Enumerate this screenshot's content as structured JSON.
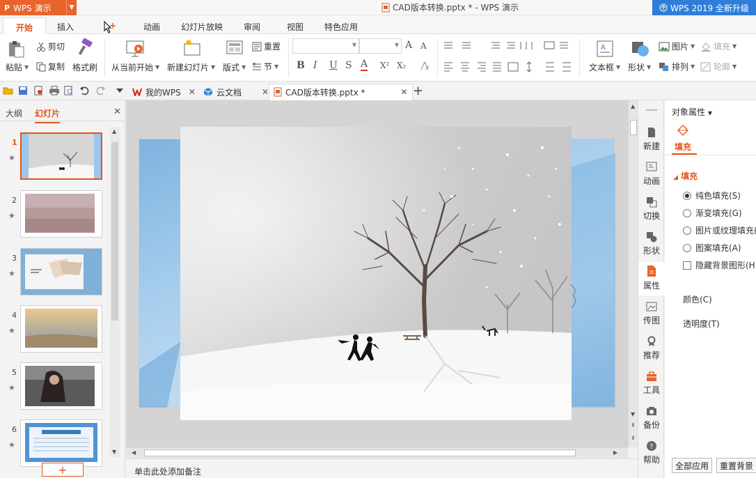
{
  "titlebar": {
    "app_button": "WPS 演示",
    "app_logo": "P",
    "document_title": "CAD版本转换.pptx * - WPS 演示",
    "upgrade": "WPS 2019 全新升级"
  },
  "ribbon_tabs": [
    "开始",
    "插入",
    "设计",
    "动画",
    "幻灯片放映",
    "审阅",
    "视图",
    "特色应用"
  ],
  "ribbon": {
    "paste": "粘贴",
    "cut": "剪切",
    "copy": "复制",
    "format_painter": "格式刷",
    "from_current": "从当前开始",
    "new_slide": "新建幻灯片",
    "layout": "版式",
    "reset": "重置",
    "section": "节",
    "textbox": "文本框",
    "shape": "形状",
    "picture": "图片",
    "fill": "填充",
    "arrange": "排列",
    "outline": "轮廓",
    "font_size_up": "A",
    "font_size_down": "A",
    "bold": "B",
    "italic": "I",
    "underline": "U",
    "strike": "S",
    "font_color": "A",
    "superscript": "X²",
    "subscript": "X₂"
  },
  "quickbar": {
    "tabs": [
      {
        "label": "我的WPS"
      },
      {
        "label": "云文档"
      },
      {
        "label": "CAD版本转换.pptx *"
      }
    ]
  },
  "left_panel": {
    "tab_outline": "大纲",
    "tab_slides": "幻灯片",
    "slides": [
      {
        "num": "1"
      },
      {
        "num": "2"
      },
      {
        "num": "3"
      },
      {
        "num": "4"
      },
      {
        "num": "5"
      },
      {
        "num": "6"
      }
    ],
    "add": "+"
  },
  "notes": {
    "placeholder": "单击此处添加备注"
  },
  "sidebar": [
    "新建",
    "动画",
    "切换",
    "形状",
    "属性",
    "传图",
    "推荐",
    "工具",
    "备份",
    "帮助"
  ],
  "props": {
    "header": "对象属性",
    "tab_fill": "填充",
    "section_fill": "填充",
    "options": [
      {
        "label": "纯色填充(S)",
        "checked": true
      },
      {
        "label": "渐变填充(G)",
        "checked": false
      },
      {
        "label": "图片或纹理填充(",
        "checked": false
      },
      {
        "label": "图案填充(A)",
        "checked": false
      }
    ],
    "hide_bg": "隐藏背景图形(H)",
    "color": "颜色(C)",
    "transparency": "透明度(T)",
    "apply_all": "全部应用",
    "reset_bg": "重置背景"
  },
  "colors": {
    "accent": "#e0561d",
    "upgrade": "#2f7dd8",
    "app": "#e8642a"
  }
}
